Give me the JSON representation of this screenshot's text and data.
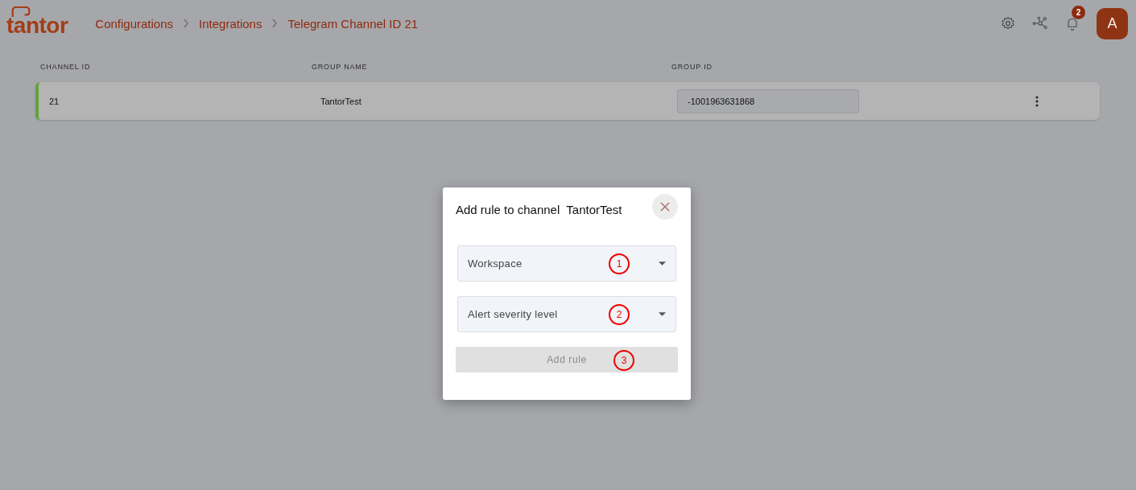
{
  "logo": {
    "text": "tantor"
  },
  "breadcrumbs": [
    {
      "label": "Configurations"
    },
    {
      "label": "Integrations"
    },
    {
      "label": "Telegram Channel ID 21"
    }
  ],
  "header": {
    "notification_count": "2",
    "avatar": "A"
  },
  "table": {
    "columns": [
      "CHANNEL ID",
      "GROUP NAME",
      "GROUP ID"
    ],
    "rows": [
      {
        "channel_id": "21",
        "group_name": "TantorTest",
        "group_id": "-1001963631868",
        "active": true
      }
    ]
  },
  "dialog": {
    "title": "Add rule to channel  TantorTest",
    "selects": [
      {
        "placeholder": "Workspace",
        "annotation": "1"
      },
      {
        "placeholder": "Alert severity level",
        "annotation": "2"
      }
    ],
    "button": {
      "label": "Add rule",
      "disabled": true,
      "annotation": "3"
    }
  }
}
